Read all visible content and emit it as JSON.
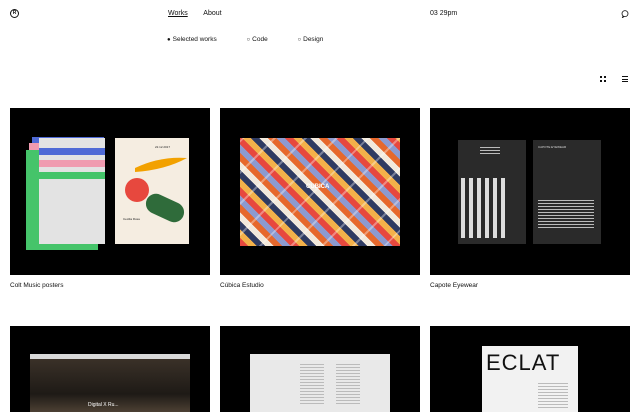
{
  "header": {
    "logo": "R",
    "nav": [
      "Works",
      "About"
    ],
    "time": "03 29pm"
  },
  "filters": [
    "Selected works",
    "Code",
    "Design"
  ],
  "projects": [
    {
      "title": "Colt Music posters"
    },
    {
      "title": "Cúbica Estudio"
    },
    {
      "title": "Capote Eyewear"
    },
    {
      "title": ""
    },
    {
      "title": ""
    },
    {
      "title": ""
    }
  ],
  "thumb_text": {
    "poster_date": "22.12.2017",
    "poster_venue": "Cecilia Rosa",
    "cubica_label": "CUBICA",
    "capote_heading": "CAPOTE EYEWEAR",
    "photo_text": "Digital X Ru...",
    "eclat": "ECLAT"
  },
  "colors": {
    "accent_red": "#e7483e",
    "poster_green": "#45c46a",
    "poster_blue": "#4f6ad6",
    "poster_pink": "#f09bb0"
  },
  "icons": [
    "logo-icon",
    "chat-icon",
    "grid-view-icon",
    "list-view-icon"
  ]
}
